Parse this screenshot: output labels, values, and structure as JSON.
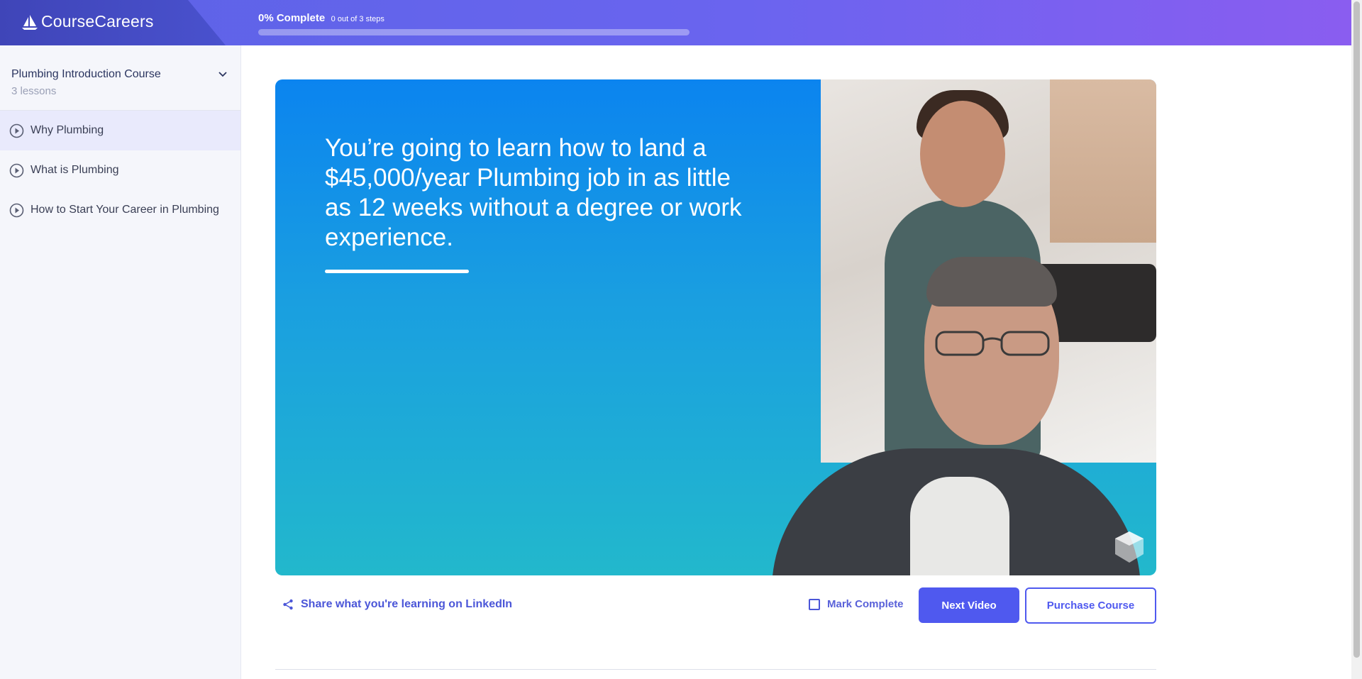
{
  "header": {
    "logo_text": "CourseCareers",
    "progress_title": "0% Complete",
    "progress_steps": "0 out of 3 steps",
    "progress_fraction": 0.0
  },
  "sidebar": {
    "course_title": "Plumbing Introduction Course",
    "lesson_count": "3 lessons",
    "lessons": [
      {
        "label": "Why Plumbing",
        "active": true
      },
      {
        "label": "What is Plumbing",
        "active": false
      },
      {
        "label": "How to Start Your Career in Plumbing",
        "active": false
      }
    ]
  },
  "video": {
    "headline": "You’re going to learn how to land a $45,000/year Plumbing job in as little as 12 weeks without a degree or work experience."
  },
  "actions": {
    "share_label": "Share what you're learning on LinkedIn",
    "mark_complete_label": "Mark Complete",
    "next_label": "Next Video",
    "purchase_label": "Purchase Course"
  },
  "colors": {
    "accent": "#4f59ef",
    "header_start": "#5b63e6",
    "header_end": "#8a5df0"
  }
}
